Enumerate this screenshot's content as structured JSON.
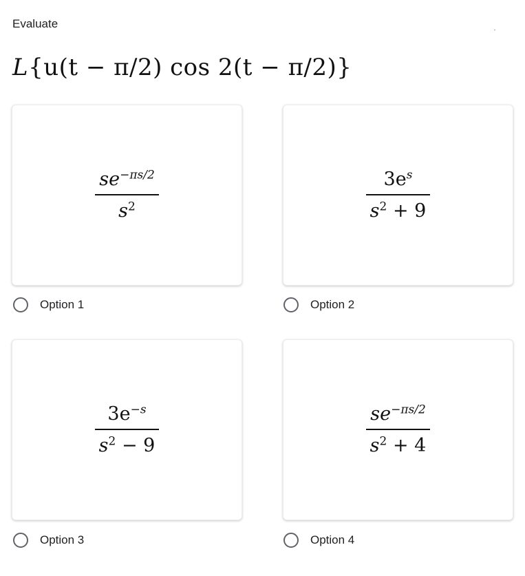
{
  "prompt": "Evaluate",
  "question": {
    "operator": "L",
    "expression": "{u(t − π/2) cos 2(t − π/2)}"
  },
  "options": [
    {
      "label": "Option 1",
      "selected": false,
      "numerator": {
        "base": "se",
        "exp": "−πs/2"
      },
      "denominator": {
        "base": "s",
        "exp": "2",
        "tail": ""
      }
    },
    {
      "label": "Option 2",
      "selected": false,
      "numerator": {
        "base": "3e",
        "exp": "s"
      },
      "denominator": {
        "base": "s",
        "exp": "2",
        "tail": " + 9"
      }
    },
    {
      "label": "Option 3",
      "selected": false,
      "numerator": {
        "base": "3e",
        "exp": "−s"
      },
      "denominator": {
        "base": "s",
        "exp": "2",
        "tail": " − 9"
      }
    },
    {
      "label": "Option 4",
      "selected": false,
      "numerator": {
        "base": "se",
        "exp": "−πs/2"
      },
      "denominator": {
        "base": "s",
        "exp": "2",
        "tail": " + 4"
      }
    }
  ]
}
